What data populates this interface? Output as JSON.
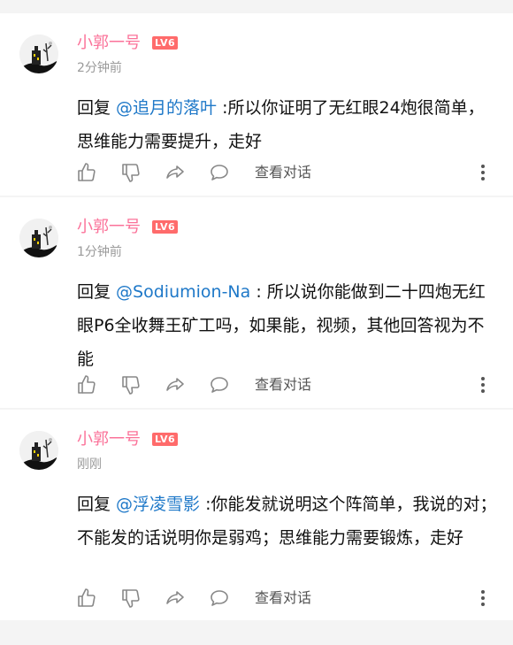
{
  "comments": [
    {
      "username": "小郭一号",
      "level": "LV6",
      "time": "2分钟前",
      "reply_prefix": "回复 ",
      "mention": "@追月的落叶",
      "text": " :所以你证明了无红眼24炮很简单，思维能力需要提升，走好",
      "view_conversation": "查看对话"
    },
    {
      "username": "小郭一号",
      "level": "LV6",
      "time": "1分钟前",
      "reply_prefix": "回复 ",
      "mention": "@Sodiumion-Na",
      "text": " : 所以说你能做到二十四炮无红眼P6全收舞王矿工吗，如果能，视频，其他回答视为不能",
      "view_conversation": "查看对话"
    },
    {
      "username": "小郭一号",
      "level": "LV6",
      "time": "刚刚",
      "reply_prefix": "回复 ",
      "mention": "@浮凌雪影",
      "text": " :你能发就说明这个阵简单，我说的对；不能发的话说明你是弱鸡；思维能力需要锻炼，走好",
      "view_conversation": "查看对话"
    }
  ],
  "colors": {
    "username": "#fb7299",
    "level_badge": "#ff6b6b",
    "mention": "#1e78c8",
    "icon": "#888888"
  },
  "icons": [
    "avatar",
    "thumbs-up-icon",
    "thumbs-down-icon",
    "share-icon",
    "comment-icon",
    "more-vertical-icon"
  ]
}
